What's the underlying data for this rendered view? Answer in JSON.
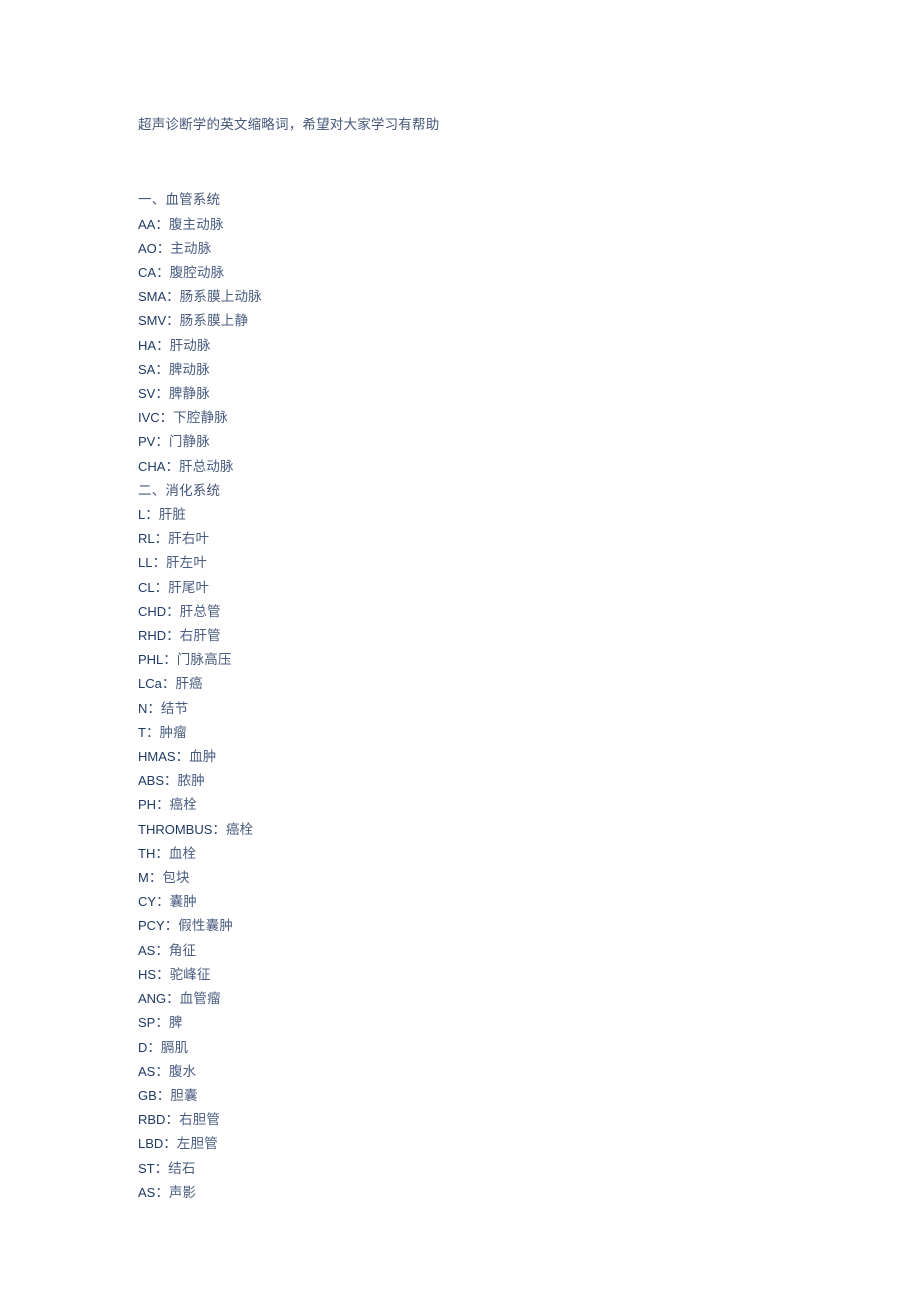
{
  "document": {
    "title_line": "超声诊断学的英文缩略词，希望对大家学习有帮助",
    "separator": "：",
    "colors": {
      "page_background": "#ffffff",
      "title_text": "#45577a",
      "abbreviation_text": "#1f3a63",
      "meaning_text": "#4a5d80",
      "section_heading_text": "#45577a"
    },
    "sections": [
      {
        "heading": "一、血管系统",
        "entries": [
          {
            "abbr": "AA",
            "meaning": "腹主动脉"
          },
          {
            "abbr": "AO",
            "meaning": "主动脉"
          },
          {
            "abbr": "CA",
            "meaning": "腹腔动脉"
          },
          {
            "abbr": "SMA",
            "meaning": "肠系膜上动脉"
          },
          {
            "abbr": "SMV",
            "meaning": "肠系膜上静"
          },
          {
            "abbr": "HA",
            "meaning": "肝动脉"
          },
          {
            "abbr": "SA",
            "meaning": "脾动脉"
          },
          {
            "abbr": "SV",
            "meaning": "脾静脉"
          },
          {
            "abbr": "IVC",
            "meaning": "下腔静脉"
          },
          {
            "abbr": "PV",
            "meaning": "门静脉"
          },
          {
            "abbr": "CHA",
            "meaning": "肝总动脉"
          }
        ]
      },
      {
        "heading": "二、消化系统",
        "entries": [
          {
            "abbr": "L",
            "meaning": "肝脏"
          },
          {
            "abbr": "RL",
            "meaning": "肝右叶"
          },
          {
            "abbr": "LL",
            "meaning": "肝左叶"
          },
          {
            "abbr": "CL",
            "meaning": "肝尾叶"
          },
          {
            "abbr": "CHD",
            "meaning": "肝总管"
          },
          {
            "abbr": "RHD",
            "meaning": "右肝管"
          },
          {
            "abbr": "PHL",
            "meaning": "门脉高压"
          },
          {
            "abbr": "LCa",
            "meaning": "肝癌"
          },
          {
            "abbr": "N",
            "meaning": "结节"
          },
          {
            "abbr": "T",
            "meaning": "肿瘤"
          },
          {
            "abbr": "HMAS",
            "meaning": "血肿"
          },
          {
            "abbr": "ABS",
            "meaning": "脓肿"
          },
          {
            "abbr": "PH",
            "meaning": "癌栓"
          },
          {
            "abbr": "THROMBUS",
            "meaning": "癌栓"
          },
          {
            "abbr": "TH",
            "meaning": "血栓"
          },
          {
            "abbr": "M",
            "meaning": "包块"
          },
          {
            "abbr": "CY",
            "meaning": "囊肿"
          },
          {
            "abbr": "PCY",
            "meaning": "假性囊肿"
          },
          {
            "abbr": "AS",
            "meaning": "角征"
          },
          {
            "abbr": "HS",
            "meaning": "驼峰征"
          },
          {
            "abbr": "ANG",
            "meaning": "血管瘤"
          },
          {
            "abbr": "SP",
            "meaning": "脾"
          },
          {
            "abbr": "D",
            "meaning": "膈肌"
          },
          {
            "abbr": "AS",
            "meaning": "腹水"
          },
          {
            "abbr": "GB",
            "meaning": "胆囊"
          },
          {
            "abbr": "RBD",
            "meaning": "右胆管"
          },
          {
            "abbr": "LBD",
            "meaning": "左胆管"
          },
          {
            "abbr": "ST",
            "meaning": "结石"
          },
          {
            "abbr": "AS",
            "meaning": "声影"
          }
        ]
      }
    ]
  }
}
